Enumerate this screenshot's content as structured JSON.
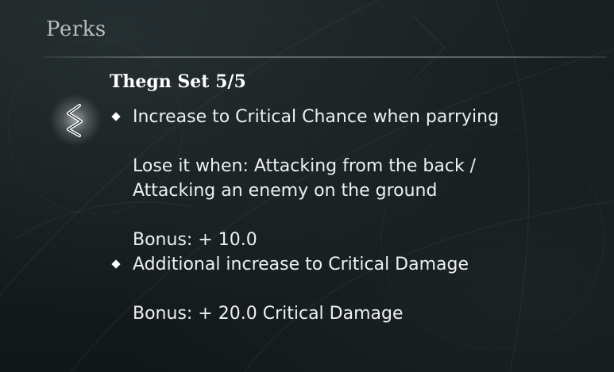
{
  "header": {
    "title": "Perks"
  },
  "perk": {
    "icon": "rune-sowilo-icon",
    "title": "Thegn Set 5/5",
    "items": [
      {
        "description": "Increase to Critical Chance when parrying",
        "lose_line_1": "Lose it when: Attacking from the back /",
        "lose_line_2": "Attacking an enemy on the ground",
        "bonus": "Bonus: + 10.0"
      },
      {
        "description": "Additional increase to Critical Damage",
        "bonus": "Bonus: + 20.0 Critical Damage"
      }
    ]
  },
  "colors": {
    "background": "#141a1c",
    "header_text": "#b9bcb8",
    "body_text": "#eef0ee",
    "title_text": "#ffffff"
  }
}
